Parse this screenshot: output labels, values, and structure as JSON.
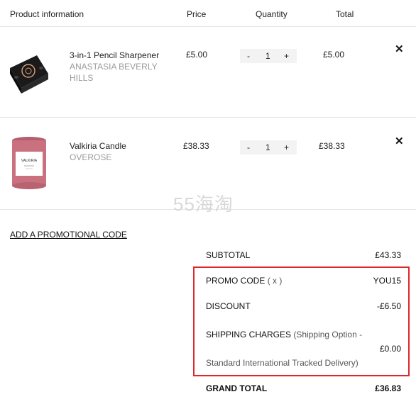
{
  "header": {
    "product_info": "Product information",
    "price": "Price",
    "quantity": "Quantity",
    "total": "Total"
  },
  "items": [
    {
      "name": "3-in-1 Pencil Sharpener",
      "brand": "ANASTASIA BEVERLY HILLS",
      "price": "£5.00",
      "quantity": "1",
      "total": "£5.00",
      "minus": "-",
      "plus": "+",
      "remove": "✕"
    },
    {
      "name": "Valkiria Candle",
      "brand": "OVEROSE",
      "price": "£38.33",
      "quantity": "1",
      "total": "£38.33",
      "minus": "-",
      "plus": "+",
      "remove": "✕",
      "label_text": "VALKIRIA"
    }
  ],
  "watermark": "55海淘",
  "promo_link": "ADD A PROMOTIONAL CODE",
  "summary": {
    "subtotal_label": "SUBTOTAL",
    "subtotal_value": "£43.33",
    "promo_label": "PROMO CODE",
    "promo_remove": "( x )",
    "promo_value": "YOU15",
    "discount_label": "DISCOUNT",
    "discount_value": "-£6.50",
    "shipping_label": "SHIPPING CHARGES",
    "shipping_option_line1": "(Shipping Option -",
    "shipping_option_line2": "Standard International Tracked Delivery)",
    "shipping_value": "£0.00",
    "grand_total_label": "GRAND TOTAL",
    "grand_total_value": "£36.83"
  },
  "colors": {
    "highlight_border": "#e0262a",
    "candle_pink": "#c9717f",
    "sharpener_black": "#1a1a1a"
  },
  "icons": {
    "remove": "close-icon"
  }
}
